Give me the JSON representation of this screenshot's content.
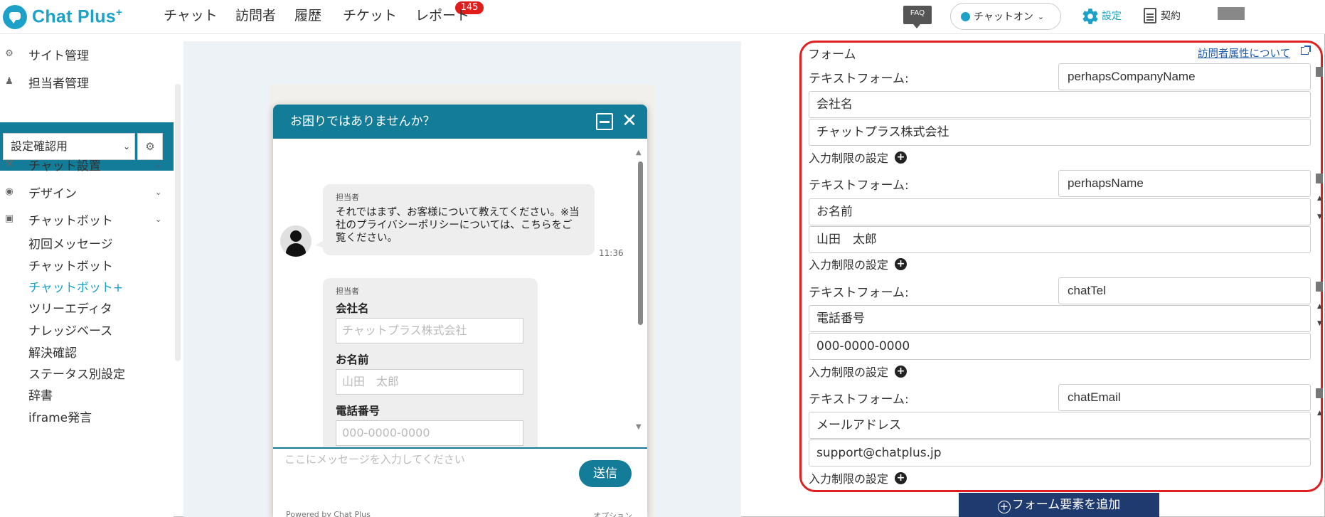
{
  "app": {
    "logo_text": "Chat Plus",
    "logo_sup": "+"
  },
  "nav": {
    "items": [
      "チャット",
      "訪問者",
      "履歴",
      "チケット",
      "レポート"
    ],
    "ticket_badge": "145",
    "faq": "FAQ",
    "chat_status": "チャットオン",
    "settings": "設定",
    "contract": "契約"
  },
  "sidebar": {
    "top_items": [
      "サイト管理",
      "担当者管理"
    ],
    "site_select": "設定確認用",
    "sections": [
      "チャット設置",
      "デザイン",
      "チャットボット"
    ],
    "sub_items": [
      "初回メッセージ",
      "チャットボット",
      "チャットボット+",
      "ツリーエディタ",
      "ナレッジベース",
      "解決確認",
      "ステータス別設定",
      "辞書",
      "iframe発言"
    ]
  },
  "widget": {
    "header": "お困りではありませんか？",
    "agent_label": "担当者",
    "message1": "それではまず、お客様について教えてください。※当社のプライバシーポリシーについては、こちらをご覧ください。",
    "time": "11:36",
    "agent_label2": "担当者",
    "fields": [
      {
        "label": "会社名",
        "placeholder": "チャットプラス株式会社"
      },
      {
        "label": "お名前",
        "placeholder": "山田　太郎"
      },
      {
        "label": "電話番号",
        "placeholder": "000-0000-0000"
      }
    ],
    "input_placeholder": "ここにメッセージを入力してください",
    "send": "送信",
    "powered": "Powered by Chat Plus",
    "option": "オプション"
  },
  "form": {
    "title": "フォーム",
    "link": "訪問者属性について",
    "row_label": "テキストフォーム:",
    "limit_label": "入力制限の設定",
    "rows": [
      {
        "key": "perhapsCompanyName",
        "label": "会社名",
        "placeholder": "チャットプラス株式会社"
      },
      {
        "key": "perhapsName",
        "label": "お名前",
        "placeholder": "山田　太郎"
      },
      {
        "key": "chatTel",
        "label": "電話番号",
        "placeholder": "000-0000-0000"
      },
      {
        "key": "chatEmail",
        "label": "メールアドレス",
        "placeholder": "support@chatplus.jp"
      }
    ],
    "add_button": "フォーム要素を追加"
  }
}
